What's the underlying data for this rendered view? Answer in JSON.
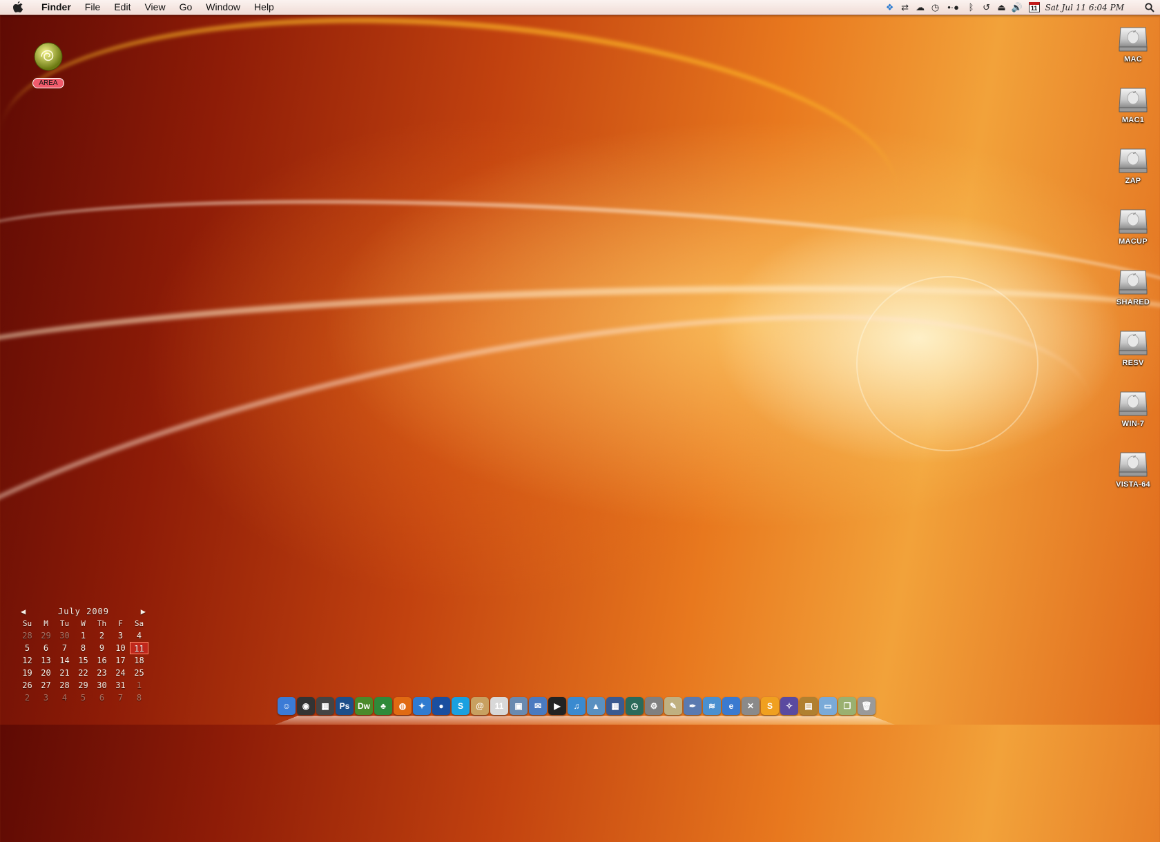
{
  "menubar": {
    "app_name": "Finder",
    "menus": [
      "File",
      "Edit",
      "View",
      "Go",
      "Window",
      "Help"
    ],
    "calendar_badge": "11",
    "clock": "Sat Jul 11  6:04 PM",
    "status_icons": [
      "dropbox-icon",
      "sync-icon",
      "cloud-icon",
      "clock-icon",
      "dots-icon",
      "bluetooth-icon",
      "time-machine-icon",
      "eject-icon",
      "volume-icon",
      "calendar-icon",
      "spotlight-icon"
    ]
  },
  "desktop": {
    "area_label": "AREA",
    "drives": [
      "MAC",
      "MAC1",
      "ZAP",
      "MACUP",
      "SHARED",
      "RESV",
      "WIN-7",
      "VISTA-64"
    ]
  },
  "calendar": {
    "prev": "◀",
    "next": "▶",
    "title": "July 2009",
    "weekdays": [
      "Su",
      "M",
      "Tu",
      "W",
      "Th",
      "F",
      "Sa"
    ],
    "weeks": [
      [
        "28",
        "29",
        "30",
        "1",
        "2",
        "3",
        "4"
      ],
      [
        "5",
        "6",
        "7",
        "8",
        "9",
        "10",
        "11"
      ],
      [
        "12",
        "13",
        "14",
        "15",
        "16",
        "17",
        "18"
      ],
      [
        "19",
        "20",
        "21",
        "22",
        "23",
        "24",
        "25"
      ],
      [
        "26",
        "27",
        "28",
        "29",
        "30",
        "31",
        "1"
      ],
      [
        "2",
        "3",
        "4",
        "5",
        "6",
        "7",
        "8"
      ]
    ],
    "today": "11"
  },
  "dock": {
    "items": [
      {
        "name": "finder-icon",
        "glyph": "☺",
        "color": "#3b7bd6"
      },
      {
        "name": "dashboard-icon",
        "glyph": "◉",
        "color": "#333"
      },
      {
        "name": "clapper-icon",
        "glyph": "▦",
        "color": "#444"
      },
      {
        "name": "photoshop-icon",
        "glyph": "Ps",
        "color": "#1d4f8a"
      },
      {
        "name": "dreamweaver-icon",
        "glyph": "Dw",
        "color": "#4a8a2a"
      },
      {
        "name": "tree-icon",
        "glyph": "♣",
        "color": "#2f8a3a"
      },
      {
        "name": "firefox-icon",
        "glyph": "◍",
        "color": "#e06a12"
      },
      {
        "name": "safari-icon",
        "glyph": "✦",
        "color": "#2f7bd0"
      },
      {
        "name": "google-earth-icon",
        "glyph": "●",
        "color": "#1a4fa0"
      },
      {
        "name": "skype-icon",
        "glyph": "S",
        "color": "#1aa0e0"
      },
      {
        "name": "address-book-icon",
        "glyph": "@",
        "color": "#c8a060"
      },
      {
        "name": "ical-icon",
        "glyph": "11",
        "color": "#d8d8d8"
      },
      {
        "name": "preview-icon",
        "glyph": "▣",
        "color": "#6a8ab0"
      },
      {
        "name": "mail-icon",
        "glyph": "✉",
        "color": "#4a7ac0"
      },
      {
        "name": "quicktime-icon",
        "glyph": "▶",
        "color": "#222"
      },
      {
        "name": "itunes-icon",
        "glyph": "♫",
        "color": "#3a8ad0"
      },
      {
        "name": "iphoto-icon",
        "glyph": "▲",
        "color": "#5a90c0"
      },
      {
        "name": "spaces-icon",
        "glyph": "▦",
        "color": "#3a5a90"
      },
      {
        "name": "time-machine-dock-icon",
        "glyph": "◷",
        "color": "#2a6a5a"
      },
      {
        "name": "system-preferences-icon",
        "glyph": "⚙",
        "color": "#808080"
      },
      {
        "name": "textedit-icon",
        "glyph": "✎",
        "color": "#c0b080"
      },
      {
        "name": "pen-tool-icon",
        "glyph": "✒",
        "color": "#5a7ab0"
      },
      {
        "name": "wifi-utility-icon",
        "glyph": "≋",
        "color": "#4a90d0"
      },
      {
        "name": "ie-icon",
        "glyph": "e",
        "color": "#3a7ad0"
      },
      {
        "name": "x11-icon",
        "glyph": "✕",
        "color": "#8a8a8a"
      },
      {
        "name": "slides-icon",
        "glyph": "S",
        "color": "#f0a020"
      },
      {
        "name": "wizard-icon",
        "glyph": "✧",
        "color": "#5a4aa0"
      },
      {
        "name": "chest-icon",
        "glyph": "▤",
        "color": "#b08030"
      },
      {
        "name": "folder-icon",
        "glyph": "▭",
        "color": "#7aaad8"
      },
      {
        "name": "documents-icon",
        "glyph": "❐",
        "color": "#9ab070"
      },
      {
        "name": "trash-icon",
        "glyph": "🗑",
        "color": "#9a9a9a"
      }
    ]
  }
}
